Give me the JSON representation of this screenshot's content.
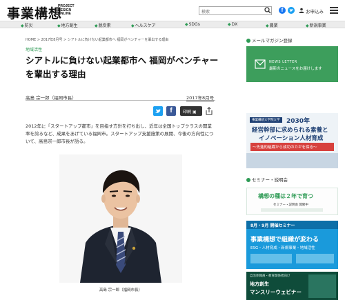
{
  "header": {
    "logo": "事業構想",
    "logo_sub": "PROJECT DESIGN ONLINE",
    "search_placeholder": "検索",
    "member_label": "お申込み"
  },
  "nav": {
    "items": [
      {
        "label": "防災",
        "icon": "shield-icon"
      },
      {
        "label": "地方創生",
        "icon": "map-icon"
      },
      {
        "label": "脱炭素",
        "icon": "leaf-icon"
      },
      {
        "label": "ヘルスケア",
        "icon": "heart-icon"
      },
      {
        "label": "SDGs",
        "icon": "globe-icon"
      },
      {
        "label": "DX",
        "icon": "chip-icon"
      },
      {
        "label": "農業",
        "icon": "sprout-icon"
      },
      {
        "label": "新規事業",
        "icon": "lightbulb-icon"
      }
    ]
  },
  "article": {
    "breadcrumb": "HOME  >  2017年8月号  >  シアトルに負けない起業都市へ 福岡がベンチャーを輩出する理由",
    "category": "地域活性",
    "title": "シアトルに負けない起業都市へ 福岡がベンチャーを輩出する理由",
    "author": "高島 宗一郎（福岡市長）",
    "date": "2017年8月号",
    "print_label": "印刷",
    "lead": "2012年に「スタートアップ都市」を目指す方針を打ち出し、近年は全国トップクラスの開業率を誇るなど、成果をあげている福岡市。スタートアップ支援施策の展開、今後の方向性について、高島宗一郎市長が語る。",
    "photo_caption": "高島 宗一郎（福岡市長）"
  },
  "sidebar": {
    "mailmag_heading": "メールマガジン登録",
    "newsletter_label": "NEWS LETTER",
    "newsletter_sub": "最新のニュースをお届けします",
    "ad1_tag": "事業構想大学院大学",
    "ad1_line1": "2030年",
    "ad1_line2": "経営幹部に求められる素養と",
    "ad1_line3": "イノベーション人材育成",
    "ad1_line4": "〜先進的組織から成功のカギを探る〜",
    "seminar_heading": "セミナー・説明会",
    "ad2_title": "構想の種は２年で育つ",
    "ad2_sub": "セミナー・説明会 開催中",
    "ad3_tag": "8月・9月 開催セミナー",
    "ad3_title": "事業構想で組織が変わる",
    "ad3_sub": "ESG・人材育成・新規事業・地域活性",
    "ad4_tag": "自治体職員・教育関係者向け",
    "ad4_title": "地方創生",
    "ad4_sub": "マンスリーウェビナー"
  },
  "colors": {
    "accent_green": "#2e9b55",
    "newsletter_green": "#3d9e5c",
    "twitter": "#1da1f2",
    "facebook": "#3b5998"
  }
}
